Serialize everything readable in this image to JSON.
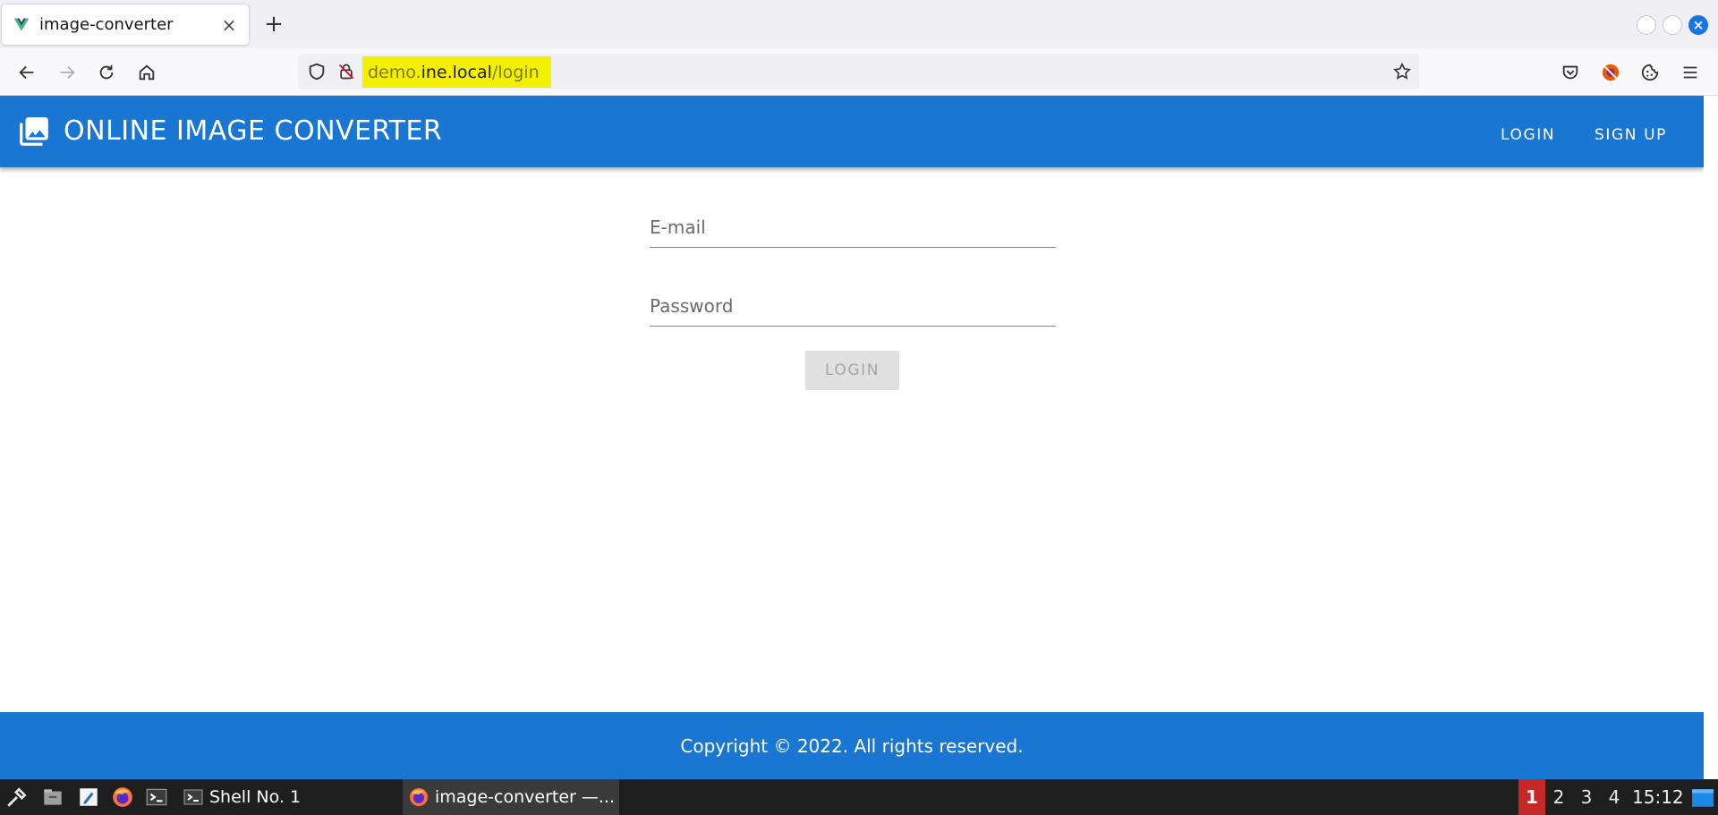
{
  "browser": {
    "tab_title": "image-converter",
    "tab_close": "×",
    "new_tab": "+",
    "url_prefix": "demo.",
    "url_domain": "ine.local",
    "url_path": "/login"
  },
  "app": {
    "title": "ONLINE IMAGE CONVERTER",
    "nav": {
      "login": "LOGIN",
      "signup": "SIGN UP"
    },
    "form": {
      "email_label": "E-mail",
      "password_label": "Password",
      "login_button": "LOGIN"
    },
    "footer": "Copyright © 2022. All rights reserved.",
    "colors": {
      "primary": "#1976d2"
    }
  },
  "taskbar": {
    "tasks": [
      {
        "label": "Shell No. 1"
      },
      {
        "label": "image-converter —..."
      }
    ],
    "workspaces": [
      "1",
      "2",
      "3",
      "4"
    ],
    "active_workspace": "1",
    "clock": "15:12"
  }
}
